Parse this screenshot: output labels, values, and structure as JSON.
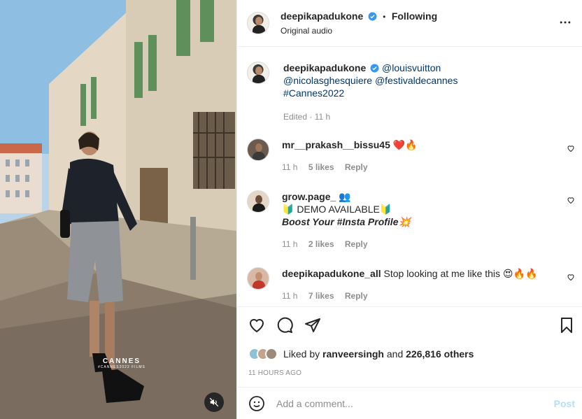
{
  "post": {
    "author": "deepikapadukone",
    "follow_status": "Following",
    "audio": "Original audio",
    "separator": "•"
  },
  "media": {
    "watermark_title": "CANNES",
    "watermark_sub": "#CANNES2022 FILMS",
    "mute_icon": "speaker-muted-icon"
  },
  "caption": {
    "author": "deepikapadukone",
    "mentions_line1": "@louisvuitton",
    "mentions_line2": "@nicolasghesquiere @festivaldecannes",
    "hashtag": "#Cannes2022",
    "edited": "Edited · 11 h"
  },
  "comments": [
    {
      "user": "mr__prakash__bissu45",
      "text": "❤️🔥",
      "time": "11 h",
      "likes": "5 likes",
      "reply": "Reply"
    },
    {
      "user": "grow.page_",
      "emoji": "👥",
      "line2": "🔰 DEMO AVAILABLE🔰",
      "line3": "Boost Your #Insta Profile💥",
      "time": "11 h",
      "likes": "2 likes",
      "reply": "Reply"
    },
    {
      "user": "deepikapadukone_all",
      "text": "Stop looking at me like this 😍🔥🔥",
      "time": "11 h",
      "likes": "7 likes",
      "reply": "Reply"
    }
  ],
  "likes": {
    "prefix": "Liked by",
    "user": "ranveersingh",
    "suffix": "and",
    "others": "226,816 others"
  },
  "timestamp": "11 HOURS AGO",
  "composer": {
    "placeholder": "Add a comment...",
    "post_label": "Post"
  },
  "colors": {
    "verified": "#3897f0",
    "link": "#00376b",
    "post_disabled": "#b2dffc",
    "muted_text": "#8e8e8e"
  }
}
